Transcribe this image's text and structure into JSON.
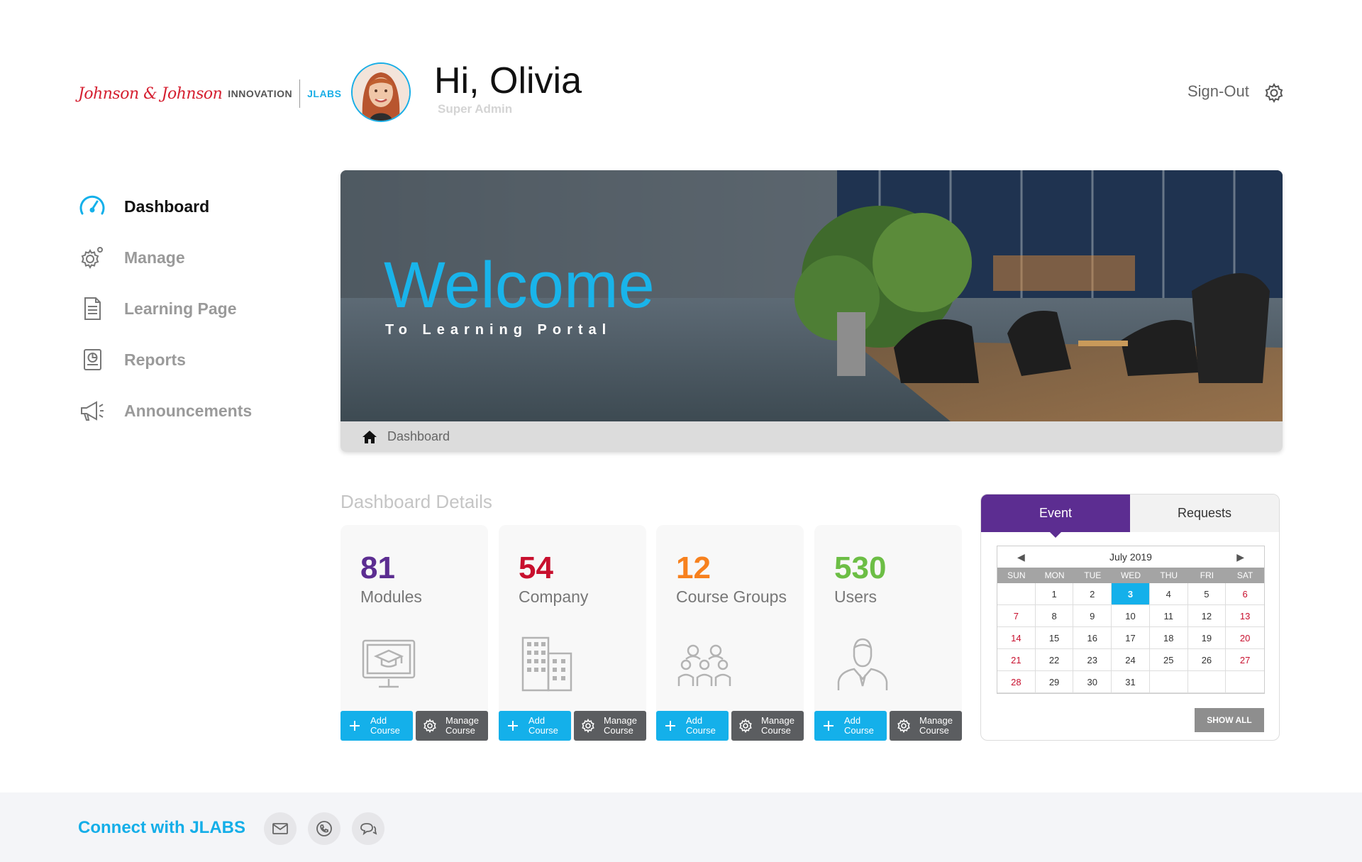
{
  "header": {
    "logo": {
      "brand": "Johnson & Johnson",
      "innovation": "INNOVATION",
      "jlabs": "JLABS"
    },
    "greeting": "Hi, Olivia",
    "role": "Super Admin",
    "signout": "Sign-Out"
  },
  "sidebar": {
    "items": [
      {
        "label": "Dashboard",
        "icon": "speedometer-icon",
        "active": true
      },
      {
        "label": "Manage",
        "icon": "gear-icon",
        "active": false
      },
      {
        "label": "Learning Page",
        "icon": "document-icon",
        "active": false
      },
      {
        "label": "Reports",
        "icon": "report-icon",
        "active": false
      },
      {
        "label": "Announcements",
        "icon": "megaphone-icon",
        "active": false
      }
    ]
  },
  "banner": {
    "title": "Welcome",
    "subtitle": "To Learning Portal",
    "breadcrumb": "Dashboard"
  },
  "details": {
    "title": "Dashboard Details",
    "cards": [
      {
        "value": "81",
        "label": "Modules",
        "color": "#5c2d91",
        "icon": "graduation-monitor-icon"
      },
      {
        "value": "54",
        "label": "Company",
        "color": "#c8102e",
        "icon": "building-icon"
      },
      {
        "value": "12",
        "label": "Course Groups",
        "color": "#f7811e",
        "icon": "group-icon"
      },
      {
        "value": "530",
        "label": "Users",
        "color": "#6cbe45",
        "icon": "user-icon"
      }
    ],
    "add_label_1": "Add",
    "add_label_2": "Course",
    "manage_label_1": "Manage",
    "manage_label_2": "Course"
  },
  "calendar": {
    "tabs": [
      "Event",
      "Requests"
    ],
    "month": "July 2019",
    "prev": "◀",
    "next": "▶",
    "days_of_week": [
      "SUN",
      "MON",
      "TUE",
      "WED",
      "THU",
      "FRI",
      "SAT"
    ],
    "cells": [
      "",
      "1",
      "2",
      "3",
      "4",
      "5",
      "6",
      "7",
      "8",
      "9",
      "10",
      "11",
      "12",
      "13",
      "14",
      "15",
      "16",
      "17",
      "18",
      "19",
      "20",
      "21",
      "22",
      "23",
      "24",
      "25",
      "26",
      "27",
      "28",
      "29",
      "30",
      "31",
      "",
      "",
      ""
    ],
    "today": "3",
    "show_all": "SHOW ALL"
  },
  "footer": {
    "connect": "Connect with JLABS",
    "icons": [
      "mail-icon",
      "phone-icon",
      "chat-icon"
    ]
  },
  "colors": {
    "accent": "#14b0ea",
    "purple": "#5c2d91",
    "manage": "#5b5d60"
  }
}
